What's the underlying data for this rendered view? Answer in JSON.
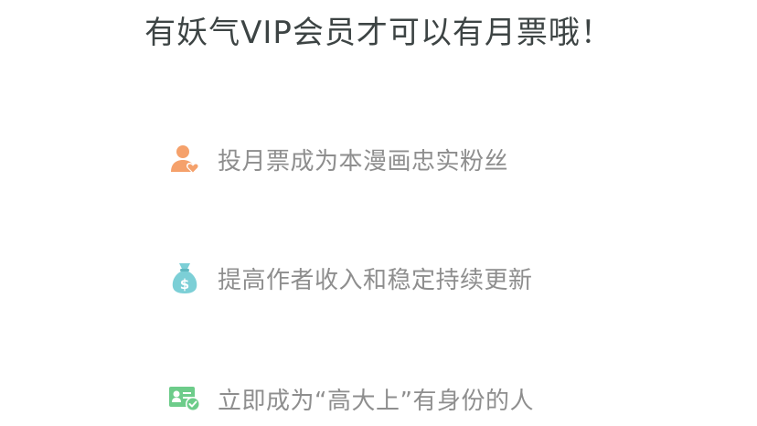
{
  "title": "有妖气VIP会员才可以有月票哦！",
  "benefits": [
    {
      "icon": "fan-user-heart-icon",
      "label": "投月票成为本漫画忠实粉丝",
      "color": "#f5a16b"
    },
    {
      "icon": "money-bag-icon",
      "label": "提高作者收入和稳定持续更新",
      "color": "#7ccfd6"
    },
    {
      "icon": "verified-id-card-icon",
      "label": "立即成为“高大上”有身份的人",
      "color": "#6dcc8a"
    }
  ]
}
